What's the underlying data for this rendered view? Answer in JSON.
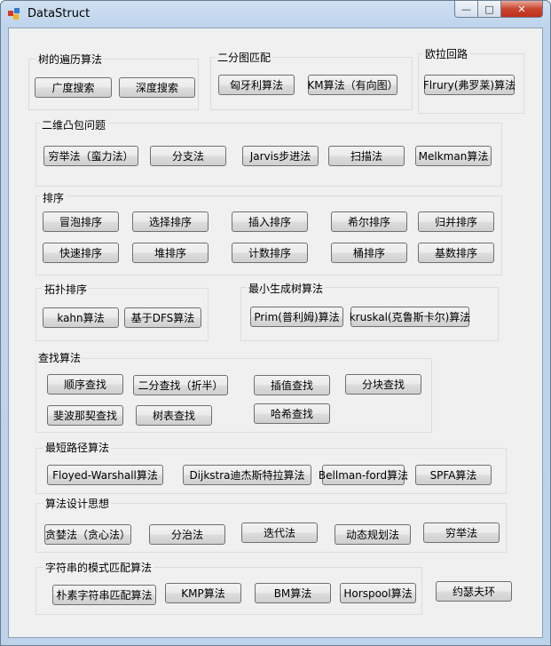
{
  "window": {
    "title": "DataStruct",
    "icon": "app-icon",
    "controls": {
      "minimize": "—",
      "maximize": "□",
      "close": "✕"
    }
  },
  "tree_traversal": {
    "label": "树的遍历算法",
    "buttons": [
      "广度搜索",
      "深度搜索"
    ]
  },
  "bipartite": {
    "label": "二分图匹配",
    "buttons": [
      "匈牙利算法",
      "KM算法（有向图）"
    ]
  },
  "euler": {
    "label": "欧拉回路",
    "buttons": [
      "Flrury(弗罗莱)算法"
    ]
  },
  "convex_hull": {
    "label": "二维凸包问题",
    "buttons": [
      "穷举法（蛮力法）",
      "分支法",
      "Jarvis步进法",
      "扫描法",
      "Melkman算法"
    ]
  },
  "sorting": {
    "label": "排序",
    "buttons": [
      "冒泡排序",
      "选择排序",
      "插入排序",
      "希尔排序",
      "归并排序",
      "快速排序",
      "堆排序",
      "计数排序",
      "桶排序",
      "基数排序"
    ]
  },
  "topo": {
    "label": "拓扑排序",
    "buttons": [
      "kahn算法",
      "基于DFS算法"
    ]
  },
  "mst": {
    "label": "最小生成树算法",
    "buttons": [
      "Prim(普利姆)算法",
      "kruskal(克鲁斯卡尔)算法"
    ]
  },
  "search": {
    "label": "查找算法",
    "buttons": [
      "顺序查找",
      "二分查找（折半）",
      "插值查找",
      "分块查找",
      "斐波那契查找",
      "树表查找",
      "哈希查找"
    ]
  },
  "shortest_path": {
    "label": "最短路径算法",
    "buttons": [
      "Floyed-Warshall算法",
      "Dijkstra迪杰斯特拉算法",
      "Bellman-ford算法",
      "SPFA算法"
    ]
  },
  "design": {
    "label": "算法设计思想",
    "buttons": [
      "贪婪法（贪心法）",
      "分治法",
      "迭代法",
      "动态规划法",
      "穷举法"
    ]
  },
  "string_match": {
    "label": "字符串的模式匹配算法",
    "buttons": [
      "朴素字符串匹配算法",
      "KMP算法",
      "BM算法",
      "Horspool算法"
    ]
  },
  "josephus": {
    "label": "约瑟夫环"
  }
}
